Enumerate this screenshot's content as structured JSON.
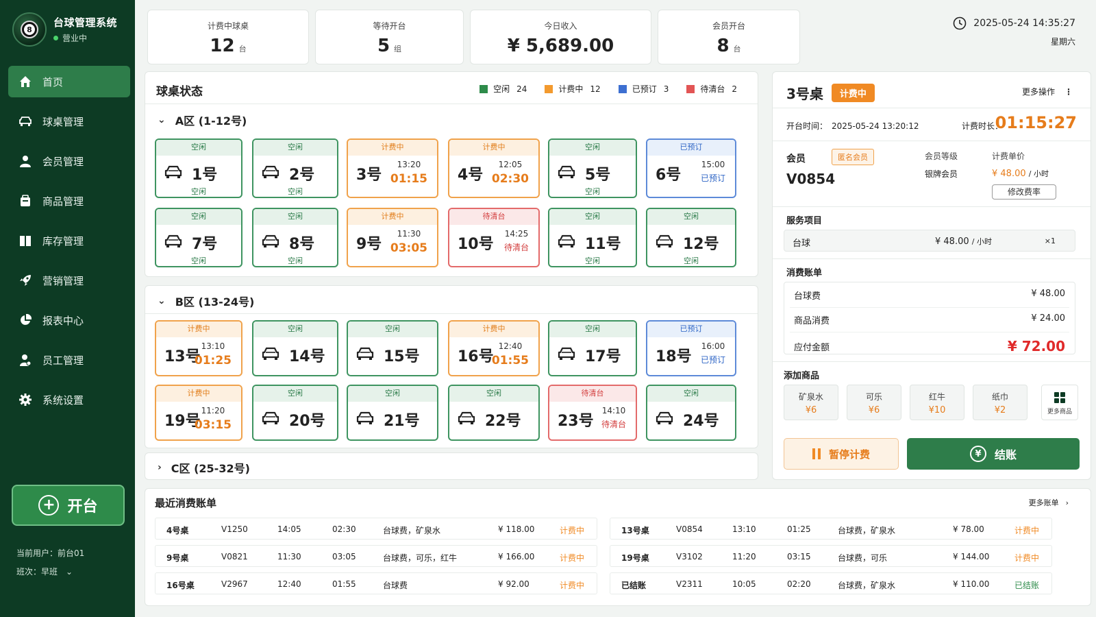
{
  "app": {
    "title": "台球管理系统",
    "status": "营业中",
    "logo_number": "8"
  },
  "nav": [
    {
      "label": "首页",
      "icon": "home-icon",
      "active": true
    },
    {
      "label": "球桌管理",
      "icon": "table-icon"
    },
    {
      "label": "会员管理",
      "icon": "user-icon"
    },
    {
      "label": "商品管理",
      "icon": "goods-icon"
    },
    {
      "label": "库存管理",
      "icon": "box-icon"
    },
    {
      "label": "营销管理",
      "icon": "rocket-icon"
    },
    {
      "label": "报表中心",
      "icon": "pie-chart-icon"
    },
    {
      "label": "员工管理",
      "icon": "staff-icon"
    },
    {
      "label": "系统设置",
      "icon": "gear-icon"
    }
  ],
  "open_table_button": "开台",
  "user": {
    "current": "当前用户：前台01",
    "shift": "班次：早班"
  },
  "stats": [
    {
      "label": "计费中球桌",
      "value": "12",
      "unit": "台"
    },
    {
      "label": "等待开台",
      "value": "5",
      "unit": "组"
    },
    {
      "label": "今日收入",
      "value": "¥ 5,689.00",
      "unit": ""
    },
    {
      "label": "会员开台",
      "value": "8",
      "unit": "台"
    }
  ],
  "clock": {
    "datetime": "2025-05-24  14:35:27",
    "weekday": "星期六"
  },
  "table_status": {
    "title": "球桌状态",
    "legend": [
      {
        "label": "空闲",
        "count": "24",
        "color": "#2e8b4a"
      },
      {
        "label": "计费中",
        "count": "12",
        "color": "#f39a2e"
      },
      {
        "label": "已预订",
        "count": "3",
        "color": "#3d6fd1"
      },
      {
        "label": "待清台",
        "count": "2",
        "color": "#e25555"
      }
    ]
  },
  "areas": {
    "a": {
      "title": "A区 (1-12号)"
    },
    "b": {
      "title": "B区 (13-24号)"
    },
    "c": {
      "title": "C区 (25-32号)"
    }
  },
  "tables_a": [
    {
      "name": "1号",
      "status": "free",
      "top": "空闲",
      "foot": "空闲"
    },
    {
      "name": "2号",
      "status": "free",
      "top": "空闲",
      "foot": "空闲"
    },
    {
      "name": "3号",
      "status": "busy",
      "top": "计费中",
      "time": "13:20",
      "dur": "01:15"
    },
    {
      "name": "4号",
      "status": "busy",
      "top": "计费中",
      "time": "12:05",
      "dur": "02:30"
    },
    {
      "name": "5号",
      "status": "free",
      "top": "空闲",
      "foot": "空闲"
    },
    {
      "name": "6号",
      "status": "resv",
      "top": "已预订",
      "time": "15:00",
      "st": "已预订"
    },
    {
      "name": "7号",
      "status": "free",
      "top": "空闲",
      "foot": "空闲"
    },
    {
      "name": "8号",
      "status": "free",
      "top": "空闲",
      "foot": "空闲"
    },
    {
      "name": "9号",
      "status": "busy",
      "top": "计费中",
      "time": "11:30",
      "dur": "03:05"
    },
    {
      "name": "10号",
      "status": "clean",
      "top": "待清台",
      "time": "14:25",
      "st": "待清台"
    },
    {
      "name": "11号",
      "status": "free",
      "top": "空闲",
      "foot": "空闲"
    },
    {
      "name": "12号",
      "status": "free",
      "top": "空闲",
      "foot": "空闲"
    }
  ],
  "tables_b": [
    {
      "name": "13号",
      "status": "busy",
      "top": "计费中",
      "time": "13:10",
      "dur": "01:25"
    },
    {
      "name": "14号",
      "status": "free",
      "top": "空闲"
    },
    {
      "name": "15号",
      "status": "free",
      "top": "空闲"
    },
    {
      "name": "16号",
      "status": "busy",
      "top": "计费中",
      "time": "12:40",
      "dur": "01:55"
    },
    {
      "name": "17号",
      "status": "free",
      "top": "空闲"
    },
    {
      "name": "18号",
      "status": "resv",
      "top": "已预订",
      "time": "16:00",
      "st": "已预订"
    },
    {
      "name": "19号",
      "status": "busy",
      "top": "计费中",
      "time": "11:20",
      "dur": "03:15"
    },
    {
      "name": "20号",
      "status": "free",
      "top": "空闲"
    },
    {
      "name": "21号",
      "status": "free",
      "top": "空闲"
    },
    {
      "name": "22号",
      "status": "free",
      "top": "空闲"
    },
    {
      "name": "23号",
      "status": "clean",
      "top": "待清台",
      "time": "14:10",
      "st": "待清台"
    },
    {
      "name": "24号",
      "status": "free",
      "top": "空闲"
    }
  ],
  "detail": {
    "table": "3号桌",
    "status": "计费中",
    "more": "更多操作",
    "start_label": "开台时间：",
    "start_time": "2025-05-24 13:20:12",
    "dur_label": "计费时长：",
    "duration": "01:15:27",
    "member_label": "会员",
    "member_tag": "匿名会员",
    "member_id": "V0854",
    "level_label": "会员等级",
    "level": "银牌会员",
    "price_label": "计费单价",
    "price": "¥ 48.00",
    "price_unit": "/ 小时",
    "change_rate": "修改费率",
    "service_title": "服务项目",
    "service": {
      "name": "台球",
      "price": "¥ 48.00",
      "unit": "/ 小时",
      "qty": "×1"
    },
    "bill_title": "消费账单",
    "bill": [
      {
        "label": "台球费",
        "value": "¥ 48.00"
      },
      {
        "label": "商品消费",
        "value": "¥ 24.00"
      }
    ],
    "total_label": "应付金额",
    "total": "¥ 72.00",
    "add_goods_title": "添加商品",
    "goods": [
      {
        "name": "矿泉水",
        "price": "¥6"
      },
      {
        "name": "可乐",
        "price": "¥6"
      },
      {
        "name": "红牛",
        "price": "¥10"
      },
      {
        "name": "纸巾",
        "price": "¥2"
      }
    ],
    "more_goods": "更多商品",
    "pause": "暂停计费",
    "checkout": "结账"
  },
  "recent": {
    "title": "最近消费账单",
    "more": "更多账单",
    "rows": [
      {
        "table": "4号桌",
        "member": "V1250",
        "start": "14:05",
        "dur": "02:30",
        "items": "台球费，矿泉水",
        "amount": "¥ 118.00",
        "status": "计费中",
        "done": false
      },
      {
        "table": "13号桌",
        "member": "V0854",
        "start": "13:10",
        "dur": "01:25",
        "items": "台球费，矿泉水",
        "amount": "¥ 78.00",
        "status": "计费中",
        "done": false
      },
      {
        "table": "9号桌",
        "member": "V0821",
        "start": "11:30",
        "dur": "03:05",
        "items": "台球费，可乐，红牛",
        "amount": "¥ 166.00",
        "status": "计费中",
        "done": false
      },
      {
        "table": "19号桌",
        "member": "V3102",
        "start": "11:20",
        "dur": "03:15",
        "items": "台球费，可乐",
        "amount": "¥ 144.00",
        "status": "计费中",
        "done": false
      },
      {
        "table": "16号桌",
        "member": "V2967",
        "start": "12:40",
        "dur": "01:55",
        "items": "台球费",
        "amount": "¥ 92.00",
        "status": "计费中",
        "done": false
      },
      {
        "table": "已结账",
        "member": "V2311",
        "start": "10:05",
        "dur": "02:20",
        "items": "台球费，矿泉水",
        "amount": "¥ 110.00",
        "status": "已结账",
        "done": true
      }
    ]
  }
}
